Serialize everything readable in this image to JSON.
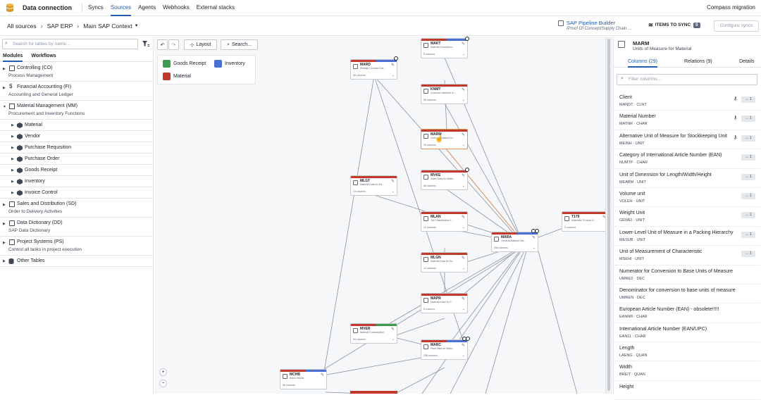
{
  "app": {
    "title": "Data connection",
    "tabs": [
      "Syncs",
      "Sources",
      "Agents",
      "Webhooks",
      "External stacks"
    ],
    "active_tab": "Sources",
    "workspace": "Compass migration"
  },
  "breadcrumb": {
    "items": [
      "All sources",
      "SAP ERP",
      "Main SAP Context"
    ]
  },
  "header_right": {
    "pipeline_title": "SAP Pipeline Builder",
    "pipeline_path": "/Proof Of Concept/Supply Chain ...",
    "items_to_sync_label": "ITEMS TO SYNC",
    "items_to_sync_count": "0",
    "configure_label": "Configure syncs"
  },
  "left_panel": {
    "search_placeholder": "Search for tables by name...",
    "tabs": [
      "Modules",
      "Workflows"
    ],
    "modules": [
      {
        "name": "Controlling (CO)",
        "desc": "Process Management"
      },
      {
        "name": "Financial Accounting (FI)",
        "desc": "Accounting and General Ledger"
      },
      {
        "name": "Material Management (MM)",
        "desc": "Procurement and Inventory Functions"
      }
    ],
    "mm_children": [
      "Material",
      "Vendor",
      "Purchase Requisition",
      "Purchase Order",
      "Goods Receipt",
      "Inventory",
      "Invoice Control"
    ],
    "modules_after": [
      {
        "name": "Sales and Distribution (SD)",
        "desc": "Order to Delivery Activities"
      },
      {
        "name": "Data Dictionary (DD)",
        "desc": "SAP Data Dictionary"
      },
      {
        "name": "Project Systems (PS)",
        "desc": "Control all tasks in project execution"
      }
    ],
    "other": "Other Tables"
  },
  "canvas": {
    "layout_label": "Layout",
    "search_label": "Search...",
    "legend": [
      {
        "label": "Goods Receipt",
        "color": "#3d9a4f"
      },
      {
        "label": "Inventory",
        "color": "#4a6fd1"
      },
      {
        "label": "Material",
        "color": "#c0392b"
      }
    ],
    "nodes": [
      {
        "name": "MAKT",
        "desc": "Material Description...",
        "cols": "5 columns"
      },
      {
        "name": "MARD",
        "desc": "Storage Location Dat...",
        "cols": "58 columns"
      },
      {
        "name": "KNMT",
        "desc": "Customer-Material In...",
        "cols": "56 columns"
      },
      {
        "name": "MARM",
        "desc": "Units of Measure for...",
        "cols": "29 columns"
      },
      {
        "name": "MLGT",
        "desc": "Material Data for Ea...",
        "cols": "13 columns"
      },
      {
        "name": "MVKE",
        "desc": "Sales Data for Mater...",
        "cols": "68 columns"
      },
      {
        "name": "MLAN",
        "desc": "Tax Classification f...",
        "cols": "13 columns"
      },
      {
        "name": "T179",
        "desc": "Materials: Product H...",
        "cols": "5 columns"
      },
      {
        "name": "MARA",
        "desc": "General Material Dat...",
        "cols": "256 columns"
      },
      {
        "name": "MLGN",
        "desc": "Material Data for Ea...",
        "cols": "14 columns"
      },
      {
        "name": "MAPR",
        "desc": "Material Index for F...",
        "cols": "8 columns"
      },
      {
        "name": "MVER",
        "desc": "Material Consumption",
        "cols": "94 columns"
      },
      {
        "name": "MARC",
        "desc": "Plant Data for Mater...",
        "cols": "238 columns"
      },
      {
        "name": "MCHB",
        "desc": "Batch Stocks",
        "cols": "56 columns"
      }
    ]
  },
  "right_panel": {
    "title": "MARM",
    "subtitle": "Units of Measure for Material",
    "tabs": [
      "Columns (29)",
      "Relations (9)",
      "Details"
    ],
    "filter_placeholder": "Filter columns...",
    "columns": [
      {
        "name": "Client",
        "meta": "MANDT · CLNT",
        "key": true,
        "rel": "↔ 1"
      },
      {
        "name": "Material Number",
        "meta": "MATNR · CHAR",
        "key": true,
        "rel": "↔ 1"
      },
      {
        "name": "Alternative Unit of Measure for Stockkeeping Unit",
        "meta": "MEINH · UNIT",
        "key": true,
        "rel": "↔ 1"
      },
      {
        "name": "Category of International Article Number (EAN)",
        "meta": "NUMTP · CHAR",
        "key": false,
        "rel": "↔ 1"
      },
      {
        "name": "Unit of Dimension for Length/Width/Height",
        "meta": "MEABM · UNIT",
        "key": false,
        "rel": "↔ 1"
      },
      {
        "name": "Volume unit",
        "meta": "VOLEH · UNIT",
        "key": false,
        "rel": "↔ 1"
      },
      {
        "name": "Weight Unit",
        "meta": "GEWEI · UNIT",
        "key": false,
        "rel": "↔ 1"
      },
      {
        "name": "Lower-Level Unit of Measure in a Packing Hierarchy",
        "meta": "MESUB · UNIT",
        "key": false,
        "rel": "↔ 1"
      },
      {
        "name": "Unit of Measurement of Characteristic",
        "meta": "MSEHI · UNIT",
        "key": false,
        "rel": "↔ 1"
      },
      {
        "name": "Numerator for Conversion to Base Units of Measure",
        "meta": "UMREZ · DEC",
        "key": false,
        "rel": ""
      },
      {
        "name": "Denominator for conversion to base units of measure",
        "meta": "UMREN · DEC",
        "key": false,
        "rel": ""
      },
      {
        "name": "European Article Number (EAN) - obsolete!!!!!",
        "meta": "EANNR · CHAR",
        "key": false,
        "rel": ""
      },
      {
        "name": "International Article Number (EAN/UPC)",
        "meta": "EAN11 · CHAR",
        "key": false,
        "rel": ""
      },
      {
        "name": "Length",
        "meta": "LAENG · QUAN",
        "key": false,
        "rel": ""
      },
      {
        "name": "Width",
        "meta": "BREIT · QUAN",
        "key": false,
        "rel": ""
      },
      {
        "name": "Height",
        "meta": "",
        "key": false,
        "rel": ""
      }
    ]
  }
}
